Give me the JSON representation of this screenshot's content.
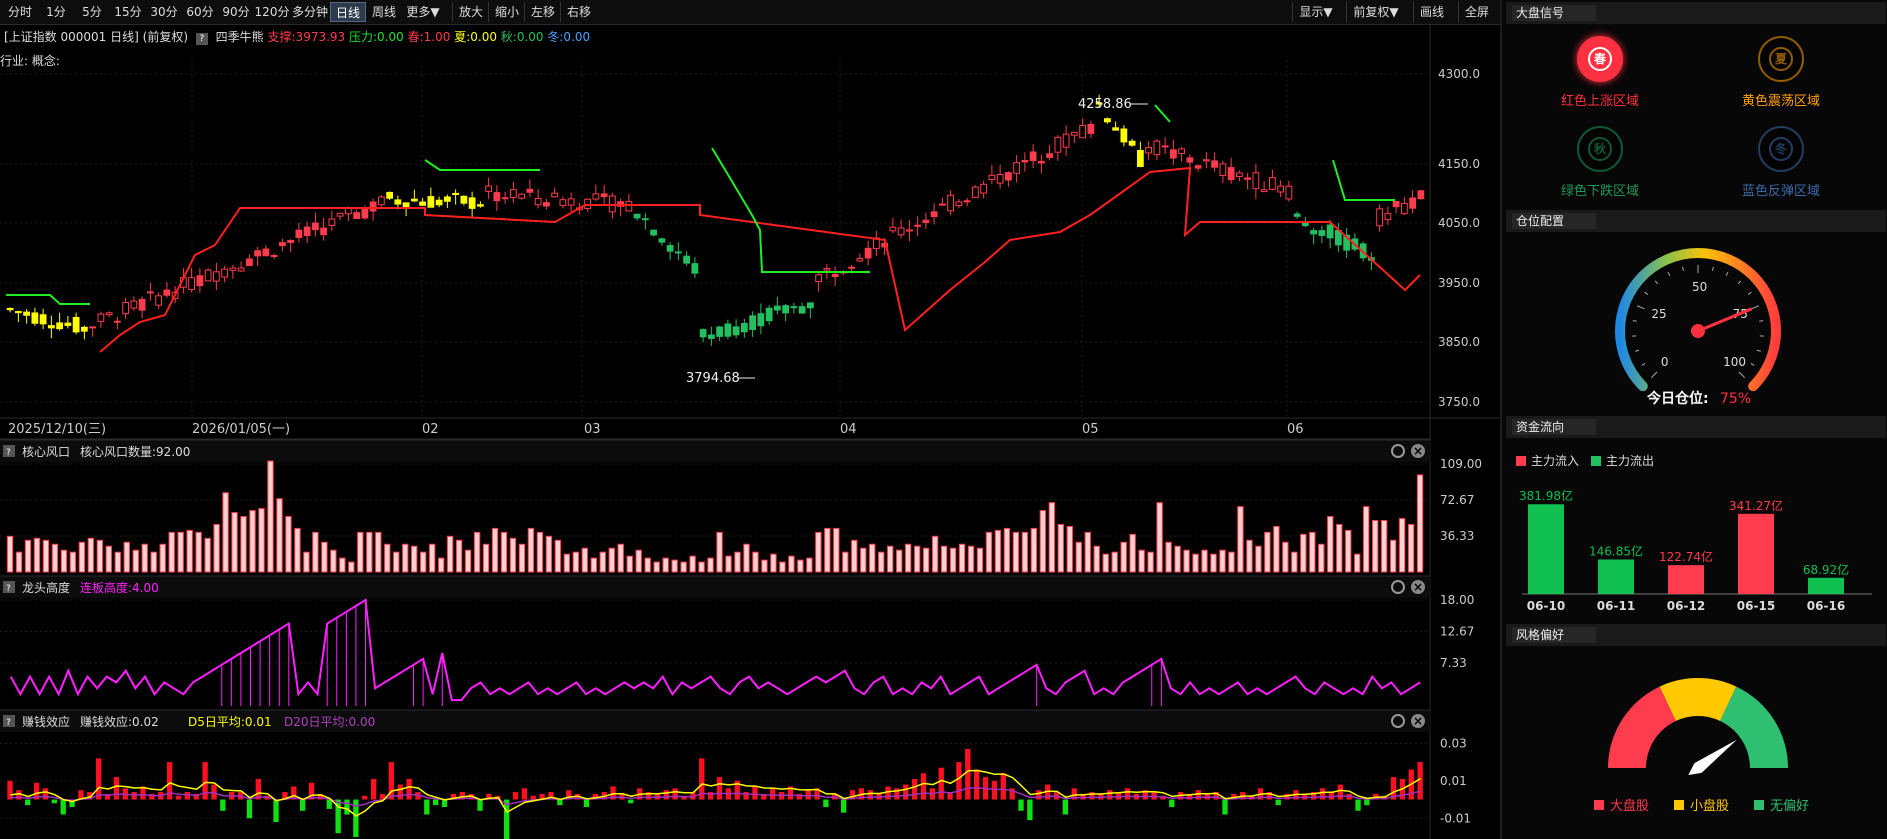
{
  "toolbar": {
    "left": [
      "分时",
      "1分",
      "5分",
      "15分",
      "30分",
      "60分",
      "90分",
      "120分",
      "多分钟",
      "日线",
      "周线",
      "更多▼",
      "放大",
      "缩小",
      "左移",
      "右移"
    ],
    "right": [
      "显示▼",
      "前复权▼",
      "画线",
      "全屏"
    ],
    "active": "日线"
  },
  "info": {
    "instrument": "[上证指数 000001 日线]",
    "adjust": "(前复权)",
    "indicator_name": "四季牛熊",
    "support": "支撑:3973.93",
    "pressure": "压力:0.00",
    "spring": "春:1.00",
    "summer": "夏:0.00",
    "autumn": "秋:0.00",
    "winter": "冬:0.00",
    "industry": "行业: 概念:"
  },
  "colors": {
    "up": "#ff3b4e",
    "down": "#23c060",
    "yellow": "#ffff00",
    "support_line": "#ff2020",
    "resist_line": "#20ee20",
    "magenta": "#ff20ff",
    "grid": "#1e1e1e"
  },
  "main_chart": {
    "y_ticks": [
      "4300.0",
      "4150.0",
      "4050.0",
      "3950.0",
      "3850.0",
      "3750.0"
    ],
    "high_label": "4258.86",
    "low_label": "3794.68",
    "date_labels": [
      "2025/12/10(三)",
      "2026/01/05(一)",
      "02",
      "03",
      "04",
      "05",
      "06"
    ]
  },
  "panes": {
    "core": {
      "title": "核心风口",
      "value": "核心风口数量:92.00",
      "y_ticks": [
        "109.00",
        "72.67",
        "36.33"
      ]
    },
    "dragon": {
      "title": "龙头高度",
      "value": "连板高度:4.00",
      "y_ticks": [
        "18.00",
        "12.67",
        "7.33"
      ]
    },
    "money": {
      "title": "赚钱效应",
      "value": "赚钱效应:0.02",
      "d5": "D5日平均:0.01",
      "d20": "D20日平均:0.00",
      "y_ticks": [
        "0.03",
        "0.01",
        "-0.01"
      ]
    }
  },
  "sidebar": {
    "signal_title": "大盘信号",
    "signals": [
      {
        "char": "春",
        "label": "红色上涨区域",
        "color": "#ff3040",
        "active": true
      },
      {
        "char": "夏",
        "label": "黄色震荡区域",
        "color": "#ffa000",
        "active": false
      },
      {
        "char": "秋",
        "label": "绿色下跌区域",
        "color": "#1e9a56",
        "active": false
      },
      {
        "char": "冬",
        "label": "蓝色反弹区域",
        "color": "#3a6aa8",
        "active": false
      }
    ],
    "position_title": "仓位配置",
    "gauge_ticks": [
      "0",
      "25",
      "50",
      "75",
      "100"
    ],
    "position_label": "今日仓位:",
    "position_value": "75%",
    "position_pct": 75,
    "fund_title": "资金流向",
    "fund_in_label": "主力流入",
    "fund_out_label": "主力流出",
    "style_title": "风格偏好",
    "style_legend": [
      "大盘股",
      "小盘股",
      "无偏好"
    ],
    "style_colors": [
      "#ff3b4e",
      "#ffc800",
      "#2ec070"
    ]
  },
  "chart_data": [
    {
      "type": "bar",
      "title": "资金流向",
      "categories": [
        "06-10",
        "06-11",
        "06-12",
        "06-15",
        "06-16"
      ],
      "values": [
        381.98,
        146.85,
        122.74,
        341.27,
        68.92
      ],
      "value_labels": [
        "381.98亿",
        "146.85亿",
        "122.74亿",
        "341.27亿",
        "68.92亿"
      ],
      "flow": [
        "out",
        "out",
        "in",
        "in",
        "out"
      ],
      "ylim": [
        0,
        400
      ]
    },
    {
      "type": "bar",
      "title": "核心风口",
      "ylim": [
        0,
        109
      ],
      "values": [
        36,
        20,
        32,
        34,
        32,
        28,
        22,
        20,
        30,
        34,
        32,
        26,
        20,
        30,
        22,
        28,
        20,
        28,
        40,
        40,
        42,
        40,
        34,
        48,
        80,
        60,
        56,
        62,
        64,
        112,
        74,
        56,
        44,
        20,
        40,
        30,
        22,
        14,
        10,
        40,
        40,
        40,
        28,
        20,
        28,
        26,
        20,
        28,
        14,
        36,
        32,
        22,
        40,
        28,
        44,
        40,
        34,
        28,
        44,
        40,
        36,
        32,
        18,
        20,
        24,
        14,
        20,
        24,
        28,
        16,
        22,
        14,
        10,
        14,
        12,
        10,
        16,
        10,
        14,
        40,
        16,
        20,
        28,
        20,
        12,
        18,
        10,
        16,
        12,
        14,
        40,
        44,
        44,
        20,
        32,
        24,
        28,
        20,
        26,
        22,
        28,
        26,
        24,
        36,
        26,
        24,
        28,
        26,
        24,
        40,
        42,
        44,
        40,
        40,
        44,
        62,
        70,
        48,
        46,
        30,
        40,
        26,
        18,
        20,
        30,
        38,
        22,
        20,
        70,
        30,
        26,
        22,
        18,
        22,
        18,
        22,
        20,
        66,
        32,
        26,
        40,
        46,
        30,
        20,
        38,
        40,
        28,
        56,
        48,
        42,
        18,
        66,
        52,
        52,
        32,
        54,
        48,
        98
      ],
      "y_ticks": [
        36.33,
        72.67,
        109
      ]
    },
    {
      "type": "line",
      "title": "龙头高度",
      "ylim": [
        0,
        18
      ],
      "values": [
        5,
        2,
        5,
        2,
        5,
        2,
        6,
        2,
        5,
        3,
        5,
        4,
        6,
        3,
        5,
        2,
        4,
        3,
        2,
        4,
        5,
        6,
        7,
        8,
        9,
        10,
        11,
        12,
        13,
        14,
        2,
        4,
        2,
        14,
        15,
        16,
        17,
        18,
        3,
        4,
        5,
        6,
        7,
        8,
        2,
        9,
        1,
        1,
        3,
        4,
        2,
        3,
        2,
        3,
        4,
        2,
        3,
        2,
        3,
        4,
        2,
        3,
        2,
        3,
        4,
        3,
        4,
        3,
        5,
        2,
        4,
        3,
        4,
        5,
        3,
        2,
        4,
        5,
        3,
        4,
        3,
        2,
        3,
        4,
        5,
        4,
        5,
        6,
        3,
        2,
        4,
        5,
        2,
        3,
        2,
        4,
        3,
        5,
        2,
        3,
        4,
        5,
        2,
        3,
        4,
        5,
        6,
        7,
        3,
        2,
        4,
        5,
        6,
        2,
        3,
        2,
        4,
        5,
        6,
        7,
        8,
        3,
        2,
        4,
        2,
        3,
        2,
        3,
        4,
        2,
        3,
        2,
        3,
        4,
        5,
        3,
        2,
        4,
        3,
        2,
        3,
        2,
        5,
        3,
        4,
        2,
        3,
        4
      ]
    },
    {
      "type": "bar",
      "title": "赚钱效应",
      "ylim": [
        -0.02,
        0.035
      ],
      "values": [
        0.01,
        0.005,
        -0.003,
        0.009,
        0.006,
        -0.002,
        -0.008,
        -0.004,
        0.005,
        0.004,
        0.022,
        0.003,
        0.012,
        0.006,
        0.004,
        0.007,
        0.003,
        0.004,
        0.02,
        0.002,
        0.004,
        0.003,
        0.02,
        0.008,
        -0.006,
        0.004,
        0.004,
        -0.01,
        0.011,
        0.002,
        -0.012,
        0.004,
        0.007,
        -0.006,
        0.009,
        0.003,
        -0.005,
        -0.018,
        -0.008,
        -0.02,
        0.002,
        0.011,
        0.003,
        0.02,
        0.008,
        0.011,
        0.004,
        -0.008,
        -0.003,
        -0.004,
        0.003,
        0.004,
        0.003,
        -0.006,
        0.003,
        0.002,
        -0.03,
        0.004,
        0.006,
        0.002,
        0.003,
        0.004,
        -0.003,
        0.005,
        0.003,
        -0.004,
        0.003,
        0.004,
        0.007,
        0.003,
        -0.002,
        0.006,
        0.004,
        0.003,
        0.005,
        0.006,
        0.002,
        0.004,
        0.022,
        0.004,
        0.012,
        0.006,
        0.01,
        0.004,
        0.007,
        0.003,
        0.006,
        0.004,
        0.007,
        0.003,
        0.005,
        0.006,
        -0.004,
        0.003,
        -0.007,
        0.005,
        0.006,
        0.005,
        0.003,
        0.007,
        0.006,
        0.008,
        0.011,
        0.014,
        0.006,
        0.017,
        0.004,
        0.02,
        0.027,
        0.016,
        0.012,
        0.01,
        0.014,
        0.006,
        -0.006,
        -0.011,
        0.005,
        0.008,
        0.004,
        -0.008,
        0.006,
        0.003,
        0.004,
        0.003,
        0.005,
        0.004,
        0.006,
        0.003,
        0.005,
        0.004,
        0.002,
        -0.004,
        0.004,
        0.003,
        0.005,
        0.003,
        0.004,
        -0.008,
        0.003,
        0.004,
        0.002,
        0.006,
        0.004,
        -0.003,
        0.003,
        0.005,
        0.003,
        0.004,
        0.006,
        0.004,
        0.008,
        0.003,
        -0.006,
        -0.003,
        0.003,
        0.002,
        0.012,
        0.011,
        0.016,
        0.02
      ]
    }
  ]
}
